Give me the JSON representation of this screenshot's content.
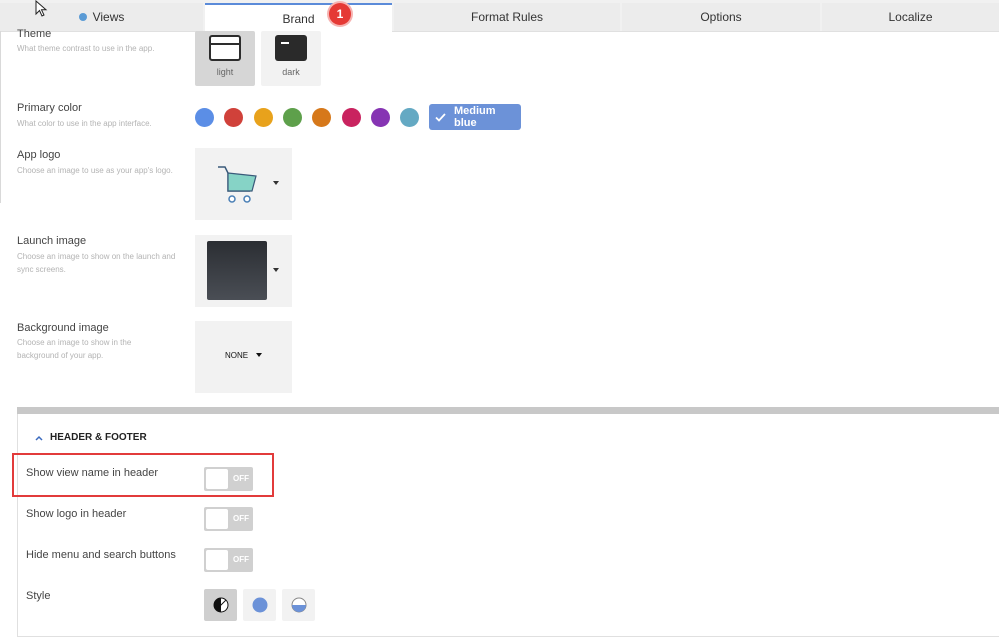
{
  "tabs": [
    {
      "label": "Views"
    },
    {
      "label": "Brand"
    },
    {
      "label": "Format Rules"
    },
    {
      "label": "Options"
    },
    {
      "label": "Localize"
    }
  ],
  "badge": "1",
  "theme": {
    "label": "Theme",
    "desc": "What theme contrast to use in the app.",
    "options": [
      "light",
      "dark"
    ],
    "selected": "light"
  },
  "primary_color": {
    "label": "Primary color",
    "desc": "What color to use in the app interface.",
    "swatches": [
      "#5b8ee6",
      "#d0413a",
      "#e8a21c",
      "#5ea04b",
      "#d6781a",
      "#c9235f",
      "#8634b3",
      "#64a9c3"
    ],
    "selected_label": "Medium blue",
    "selected_color": "#6c92d8"
  },
  "app_logo": {
    "label": "App logo",
    "desc": "Choose an image to use as your app's logo."
  },
  "launch_image": {
    "label": "Launch image",
    "desc": "Choose an image to show on the launch and sync screens."
  },
  "background_image": {
    "label": "Background image",
    "desc": "Choose an image to show in the background of your app.",
    "value": "NONE"
  },
  "header_footer": {
    "title": "HEADER & FOOTER",
    "toggles": [
      {
        "label": "Show view name in header",
        "state": "OFF"
      },
      {
        "label": "Show logo in header",
        "state": "OFF"
      },
      {
        "label": "Hide menu and search buttons",
        "state": "OFF"
      }
    ],
    "style_label": "Style"
  }
}
